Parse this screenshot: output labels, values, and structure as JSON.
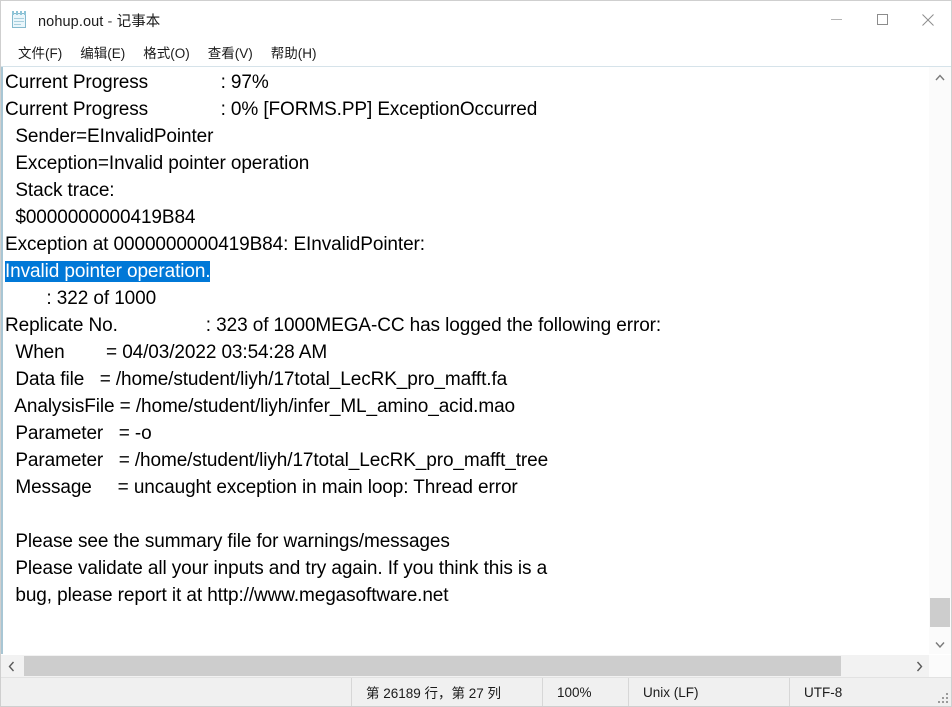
{
  "window": {
    "icon": "notepad-icon",
    "title_file": "nohup.out",
    "title_separator": " - ",
    "title_app": "记事本",
    "buttons": {
      "minimize": "minimize-icon",
      "maximize": "maximize-icon",
      "close": "close-icon"
    }
  },
  "menubar": {
    "items": [
      {
        "label": "文件(F)"
      },
      {
        "label": "编辑(E)"
      },
      {
        "label": "格式(O)"
      },
      {
        "label": "查看(V)"
      },
      {
        "label": "帮助(H)"
      }
    ]
  },
  "editor": {
    "selection_color": "#0078d7",
    "lines": [
      {
        "text": "Current Progress              : 97%"
      },
      {
        "text": "Current Progress              : 0% [FORMS.PP] ExceptionOccurred"
      },
      {
        "text": "  Sender=EInvalidPointer"
      },
      {
        "text": "  Exception=Invalid pointer operation"
      },
      {
        "text": "  Stack trace:"
      },
      {
        "text": "  $0000000000419B84"
      },
      {
        "text": "Exception at 0000000000419B84: EInvalidPointer:"
      },
      {
        "text": "Invalid pointer operation.",
        "selected": true
      },
      {
        "text": "        : 322 of 1000"
      },
      {
        "text": "Replicate No.                 : 323 of 1000MEGA-CC has logged the following error:"
      },
      {
        "text": "  When        = 04/03/2022 03:54:28 AM"
      },
      {
        "text": "  Data file   = /home/student/liyh/17total_LecRK_pro_mafft.fa"
      },
      {
        "text": "  AnalysisFile = /home/student/liyh/infer_ML_amino_acid.mao"
      },
      {
        "text": "  Parameter   = -o"
      },
      {
        "text": "  Parameter   = /home/student/liyh/17total_LecRK_pro_mafft_tree"
      },
      {
        "text": "  Message     = uncaught exception in main loop: Thread error"
      },
      {
        "text": ""
      },
      {
        "text": "  Please see the summary file for warnings/messages"
      },
      {
        "text": "  Please validate all your inputs and try again. If you think this is a"
      },
      {
        "text": "  bug, please report it at http://www.megasoftware.net"
      }
    ]
  },
  "scrollbars": {
    "vertical": {
      "up": "chevron-up-icon",
      "down": "chevron-down-icon"
    },
    "horizontal": {
      "left": "chevron-left-icon",
      "right": "chevron-right-icon"
    }
  },
  "statusbar": {
    "position": "第 26189 行，第 27 列",
    "zoom": "100%",
    "line_ending": "Unix (LF)",
    "encoding": "UTF-8"
  }
}
